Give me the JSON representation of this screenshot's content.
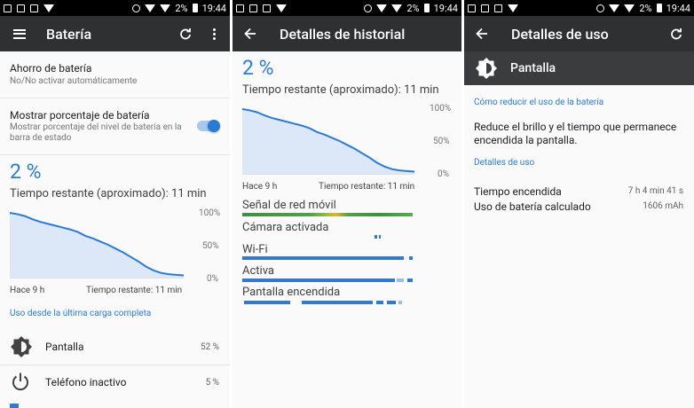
{
  "status_bar": {
    "battery": "2%",
    "time": "19:44"
  },
  "panel1": {
    "title": "Batería",
    "saver": {
      "title": "Ahorro de batería",
      "subtitle": "No/No activar automáticamente"
    },
    "percent_setting": {
      "title": "Mostrar porcentaje de batería",
      "subtitle": "Mostrar porcentaje del nivel de batería en la barra de estado",
      "enabled": true
    },
    "battery_level": "2 %",
    "remaining": "Tiempo restante (aproximado): 11 min",
    "chart": {
      "ticks": [
        "100%",
        "50%",
        "0%"
      ],
      "start_label": "Hace 9 h",
      "end_label": "Tiempo restante: 11 min"
    },
    "usage_header": "Uso desde la última carga completa",
    "usage_items": [
      {
        "label": "Pantalla",
        "value": "52 %"
      },
      {
        "label": "Teléfono inactivo",
        "value": "5 %"
      }
    ]
  },
  "panel2": {
    "title": "Detalles de historial",
    "battery_level": "2 %",
    "remaining": "Tiempo restante (aproximado): 11 min",
    "chart": {
      "ticks": [
        "100%",
        "50%",
        "0%"
      ],
      "start_label": "Hace 9 h",
      "end_label": "Tiempo restante: 11 min"
    },
    "history": [
      {
        "label": "Señal de red móvil"
      },
      {
        "label": "Cámara activada"
      },
      {
        "label": "Wi-Fi"
      },
      {
        "label": "Activa"
      },
      {
        "label": "Pantalla encendida"
      }
    ]
  },
  "panel3": {
    "title": "Detalles de uso",
    "item": "Pantalla",
    "reduce_link": "Cómo reducir el uso de la batería",
    "reduce_text": "Reduce el brillo y el tiempo que permanece encendida la pantalla.",
    "details_header": "Detalles de uso",
    "details": [
      {
        "label": "Tiempo encendida",
        "value": "7 h 4 min 41 s"
      },
      {
        "label": "Uso de batería calculado",
        "value": "1606 mAh"
      }
    ]
  },
  "chart_data": {
    "type": "area",
    "y_range": [
      0,
      100
    ],
    "x_start": "Hace 9 h",
    "x_end": "Tiempo restante: 11 min",
    "values": [
      100,
      98,
      95,
      90,
      86,
      83,
      80,
      77,
      74,
      70,
      64,
      60,
      55,
      50,
      44,
      38,
      31,
      24,
      16,
      10,
      6,
      4,
      3,
      2
    ]
  },
  "colors": {
    "accent": "#2a7bd4",
    "toolbar": "#2f3031",
    "statusbar": "#000000",
    "chart_fill": "#dce8f7"
  }
}
